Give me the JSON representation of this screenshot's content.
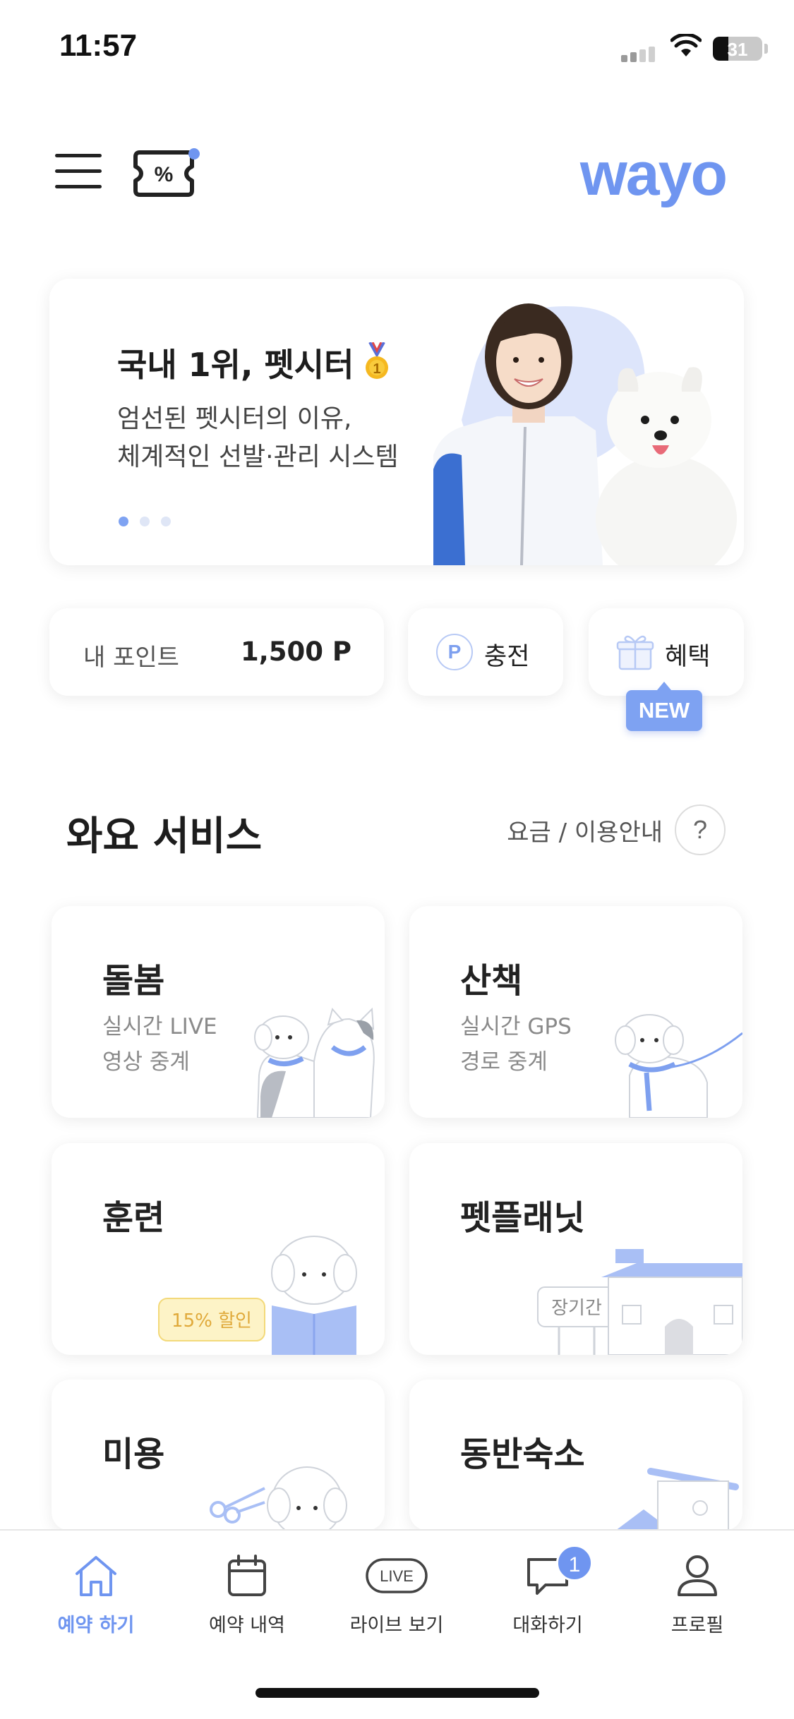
{
  "status_bar": {
    "time": "11:57",
    "battery": "31",
    "battery_level": 0.31
  },
  "header": {
    "logo": "wayo"
  },
  "banner": {
    "title": "국내 1위, 펫시터",
    "desc_line1": "엄선된 펫시터의 이유,",
    "desc_line2": "체계적인 선발·관리 시스템",
    "active_slide": 1,
    "slide_count": 3
  },
  "points": {
    "label": "내 포인트",
    "value": "1,500 P",
    "charge_icon": "P",
    "charge_label": "충전",
    "benefit_label": "혜택",
    "new_badge": "NEW"
  },
  "services_section": {
    "title": "와요 서비스",
    "link": "요금 / 이용안내",
    "help": "?"
  },
  "services": [
    {
      "name": "돌봄",
      "sub1": "실시간 LIVE",
      "sub2": "영상 중계"
    },
    {
      "name": "산책",
      "sub1": "실시간 GPS",
      "sub2": "경로 중계"
    },
    {
      "name": "훈련",
      "tag": "15% 할인"
    },
    {
      "name": "펫플래닛",
      "tag": "장기간"
    },
    {
      "name": "미용"
    },
    {
      "name": "동반숙소"
    }
  ],
  "tabbar": {
    "items": [
      {
        "label": "예약 하기",
        "icon": "home-icon",
        "active": true
      },
      {
        "label": "예약 내역",
        "icon": "calendar-icon"
      },
      {
        "label": "라이브 보기",
        "icon": "live-icon",
        "icon_text": "LIVE"
      },
      {
        "label": "대화하기",
        "icon": "chat-icon",
        "badge": "1"
      },
      {
        "label": "프로필",
        "icon": "profile-icon"
      }
    ]
  },
  "colors": {
    "accent": "#6f95f0",
    "accent_light": "#dfe6f6",
    "text": "#222222"
  }
}
